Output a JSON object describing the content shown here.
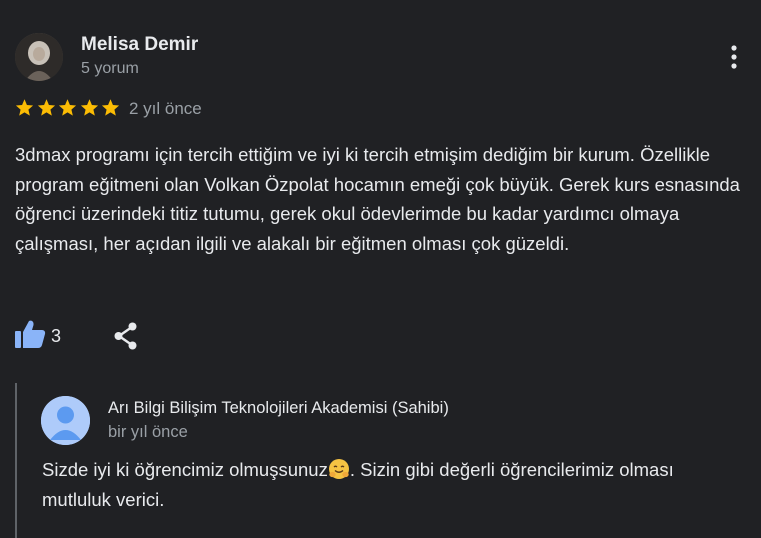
{
  "review": {
    "author_name": "Melisa Demir",
    "author_meta": "5 yorum",
    "rating": 5,
    "rating_max": 5,
    "date": "2 yıl önce",
    "text": "3dmax programı için tercih ettiğim ve iyi ki tercih etmişim dediğim bir kurum. Özellikle program eğitmeni olan Volkan Özpolat hocamın emeği çok büyük. Gerek kurs esnasında öğrenci üzerindeki titiz tutumu, gerek okul ödevlerimde bu kadar yardımcı olmaya çalışması, her açıdan ilgili ve alakalı bir eğitmen olması çok güzeldi.",
    "likes": "3"
  },
  "owner_response": {
    "name": "Arı Bilgi Bilişim Teknolojileri Akademisi (Sahibi)",
    "date": "bir yıl önce",
    "text_before_emoji": "Sizde iyi ki öğrencimiz olmuşsunuz",
    "emoji": "hugging-face",
    "text_after_emoji": ". Sizin gibi değerli öğrencilerimiz olması mutluluk verici."
  },
  "colors": {
    "background": "#202124",
    "text_primary": "#e8eaed",
    "text_secondary": "#9aa0a6",
    "star": "#fbbc04",
    "accent": "#8ab4f8",
    "owner_avatar": "#aecbfa",
    "divider": "#5f6368"
  },
  "icons": {
    "more": "more-vert-icon",
    "like": "thumb-up-icon",
    "share": "share-icon",
    "star": "star-icon"
  }
}
